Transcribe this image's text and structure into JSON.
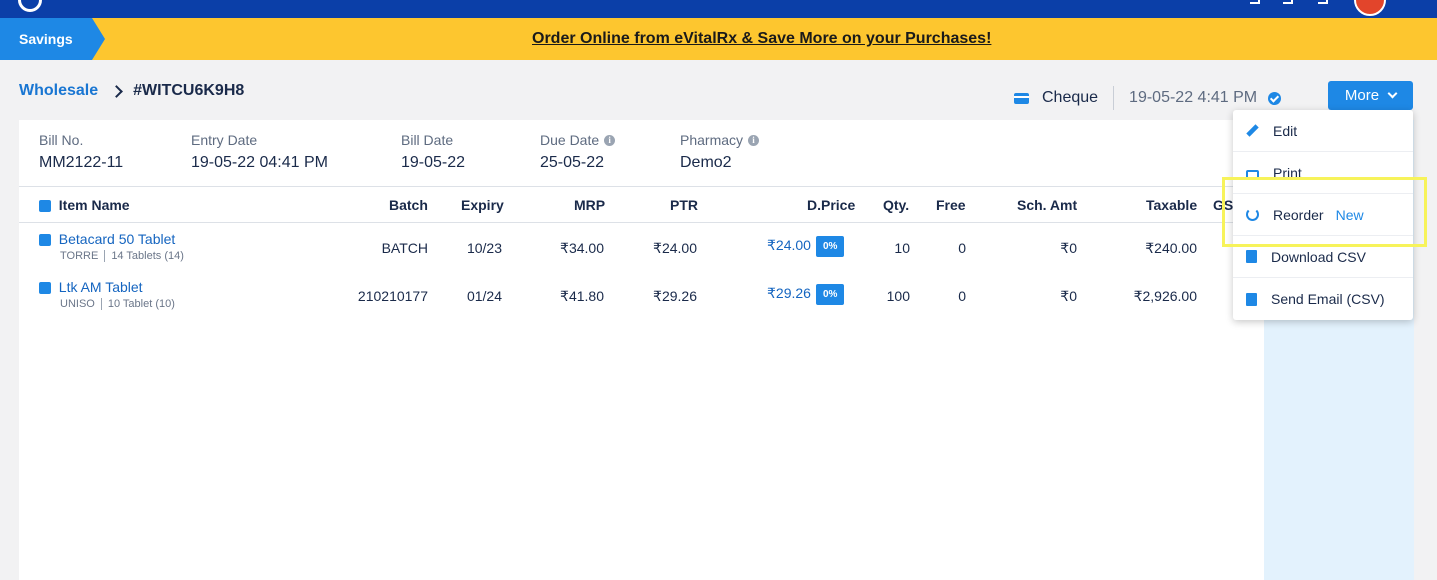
{
  "promo": {
    "badge": "Savings",
    "link_text": "Order Online from eVitalRx & Save More on your Purchases!"
  },
  "breadcrumb": {
    "parent": "Wholesale",
    "current": "#WITCU6K9H8"
  },
  "payment": {
    "mode": "Cheque",
    "datetime": "19-05-22 4:41 PM"
  },
  "more_button": "More",
  "bill_info": [
    {
      "label": "Bill No.",
      "value": "MM2122-11"
    },
    {
      "label": "Entry Date",
      "value": "19-05-22 04:41 PM"
    },
    {
      "label": "Bill Date",
      "value": "19-05-22"
    },
    {
      "label": "Due Date",
      "value": "25-05-22"
    },
    {
      "label": "Pharmacy",
      "value": "Demo2"
    }
  ],
  "info_icon_glyph": "i",
  "table": {
    "headers": {
      "item_name": "Item Name",
      "batch": "Batch",
      "expiry": "Expiry",
      "mrp": "MRP",
      "ptr": "PTR",
      "dprice": "D.Price",
      "qty": "Qty.",
      "free": "Free",
      "sch_amt": "Sch. Amt",
      "taxable": "Taxable",
      "gst": "GS"
    },
    "rows": [
      {
        "name": "Betacard 50 Tablet",
        "company": "TORRE",
        "pack": "14 Tablets (14)",
        "batch": "BATCH",
        "expiry": "10/23",
        "mrp": "₹34.00",
        "ptr": "₹24.00",
        "dprice": "₹24.00",
        "discount": "0%",
        "qty": "10",
        "free": "0",
        "sch_amt": "₹0",
        "taxable": "₹240.00"
      },
      {
        "name": "Ltk AM Tablet",
        "company": "UNISO",
        "pack": "10 Tablet (10)",
        "batch": "210210177",
        "expiry": "01/24",
        "mrp": "₹41.80",
        "ptr": "₹29.26",
        "dprice": "₹29.26",
        "discount": "0%",
        "qty": "100",
        "free": "0",
        "sch_amt": "₹0",
        "taxable": "₹2,926.00"
      }
    ]
  },
  "menu": {
    "items": [
      {
        "label": "Edit",
        "icon": "pencil-icon"
      },
      {
        "label": "Print",
        "icon": "printer-icon"
      },
      {
        "label": "Reorder",
        "icon": "reorder-icon",
        "badge": "New"
      },
      {
        "label": "Download CSV",
        "icon": "csv-file-icon"
      },
      {
        "label": "Send Email (CSV)",
        "icon": "csv-file-icon"
      }
    ]
  },
  "colors": {
    "top_nav": "#0b3fa8",
    "promo_bg": "#fdc62f",
    "accent": "#1e88e5",
    "highlight": "#f7f35a"
  }
}
